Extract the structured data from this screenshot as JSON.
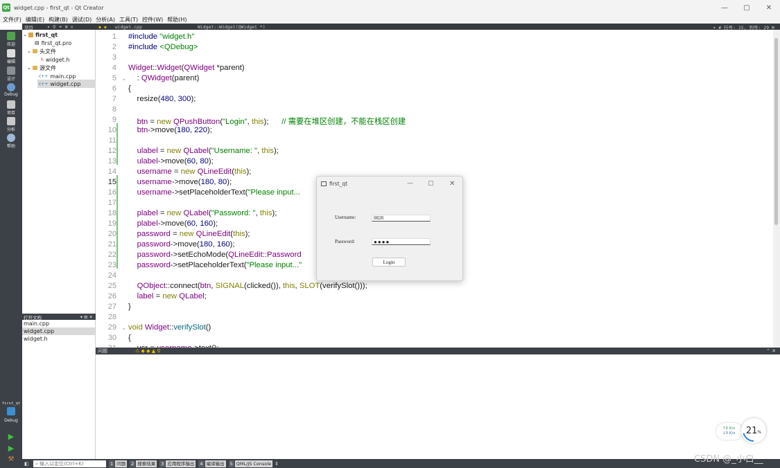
{
  "window": {
    "title": "widget.cpp - first_qt - Qt Creator",
    "min": "—",
    "max": "▢",
    "close": "✕"
  },
  "menu": [
    "文件(F)",
    "编辑(E)",
    "构建(B)",
    "调试(D)",
    "分析(A)",
    "工具(T)",
    "控件(W)",
    "帮助(H)"
  ],
  "project_header": {
    "label": "项目",
    "icons": "▾ ⚲ ⚭ ⊞ ✕"
  },
  "editor_header": {
    "nav": "◆ ◆",
    "file": "widget.cpp",
    "symbol": "Widget::Widget(QWidget *)",
    "position": "▾ # 行号: 15, 列号: 29 ⊞"
  },
  "modes": [
    {
      "name": "mode-welcome",
      "label": "欢迎",
      "color": "#52a34f"
    },
    {
      "name": "mode-edit",
      "label": "编辑",
      "color": "#dcdcdc"
    },
    {
      "name": "mode-design",
      "label": "设计",
      "color": "#8a8f95"
    },
    {
      "name": "mode-debug",
      "label": "Debug",
      "color": "#6c9bd2"
    },
    {
      "name": "mode-project",
      "label": "项目",
      "color": "#c9c9c9"
    },
    {
      "name": "mode-analyze",
      "label": "分析",
      "color": "#c9c9c9"
    },
    {
      "name": "mode-help",
      "label": "帮助",
      "color": "#9fb7d8"
    }
  ],
  "kit": {
    "project": "first_qt",
    "config": "Debug"
  },
  "tree": {
    "project": "first_qt",
    "pro": "first_qt.pro",
    "headers": "头文件",
    "header_file": "widget.h",
    "sources": "源文件",
    "source_main": "main.cpp",
    "source_widget": "widget.cpp"
  },
  "open_docs": {
    "label": "打开文档",
    "icons": "▾ ⊞ ✕",
    "items": [
      "main.cpp",
      "widget.cpp",
      "widget.h"
    ]
  },
  "line_numbers": [
    "1",
    "2",
    "3",
    "4",
    "5",
    "6",
    "7",
    "8",
    "9",
    "10",
    "11",
    "12",
    "13",
    "14",
    "15",
    "16",
    "17",
    "18",
    "19",
    "20",
    "21",
    "22",
    "23",
    "24",
    "25",
    "26",
    "27",
    "28",
    "29",
    "30",
    "31"
  ],
  "current_line": 15,
  "issues": {
    "label": "问题",
    "icons": "⚠ ◆ ◆ ▲ ⚲",
    "collapse": "⌃ ✕"
  },
  "status": {
    "locator_placeholder": "⌕ 输入以定位(Ctrl+K)",
    "tabs": [
      {
        "num": "1",
        "label": "问题"
      },
      {
        "num": "2",
        "label": "搜索结果"
      },
      {
        "num": "3",
        "label": "应用程序输出"
      },
      {
        "num": "4",
        "label": "编译输出"
      },
      {
        "num": "5",
        "label": "QML/JS Console"
      }
    ]
  },
  "dialog": {
    "title": "first_qt",
    "username_label": "Username:",
    "username_value": "0828",
    "password_label": "Password:",
    "password_value": "●●●●",
    "login": "Login"
  },
  "net": {
    "up": "↑0  K/s",
    "down": "↓0  K/s"
  },
  "cpu": {
    "value": "21",
    "unit": "%",
    "level": 0.21
  },
  "watermark": "CSDN @_小白__"
}
